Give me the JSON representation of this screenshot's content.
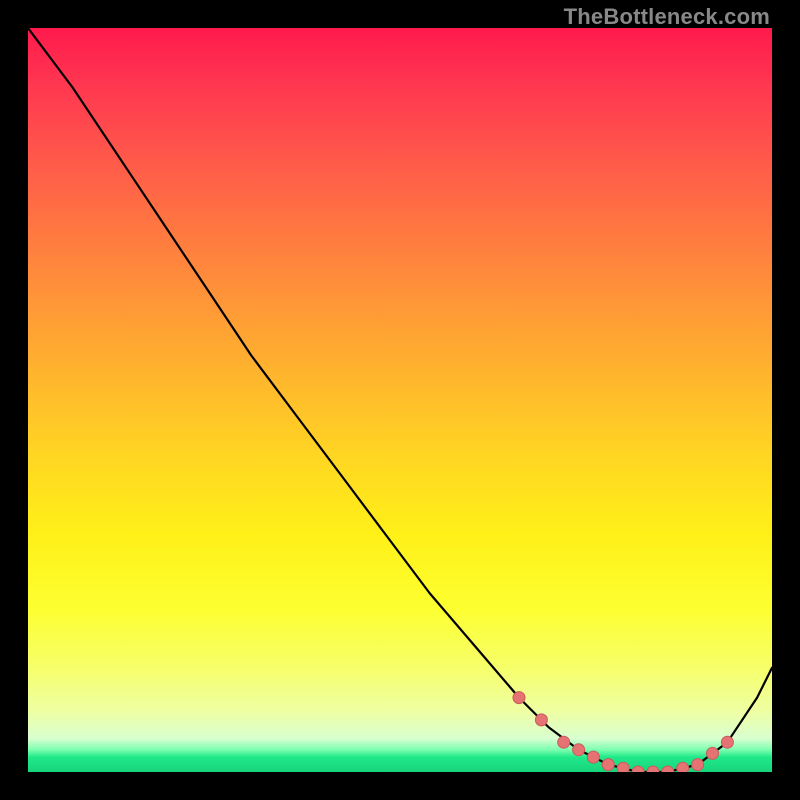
{
  "watermark": "TheBottleneck.com",
  "colors": {
    "curve": "#000000",
    "marker_fill": "#e57373",
    "marker_stroke": "#c95b5b",
    "bg_black": "#000000"
  },
  "chart_data": {
    "type": "line",
    "title": "",
    "xlabel": "",
    "ylabel": "",
    "xlim": [
      0,
      100
    ],
    "ylim": [
      0,
      100
    ],
    "grid": false,
    "legend": false,
    "series": [
      {
        "name": "curve",
        "x": [
          0,
          6,
          12,
          18,
          24,
          30,
          36,
          42,
          48,
          54,
          60,
          66,
          70,
          74,
          78,
          82,
          86,
          90,
          94,
          98,
          100
        ],
        "y": [
          100,
          92,
          83,
          74,
          65,
          56,
          48,
          40,
          32,
          24,
          17,
          10,
          6,
          3,
          1,
          0,
          0,
          1,
          4,
          10,
          14
        ]
      }
    ],
    "markers": {
      "name": "highlight-points",
      "x": [
        66,
        69,
        72,
        74,
        76,
        78,
        80,
        82,
        84,
        86,
        88,
        90,
        92,
        94
      ],
      "y": [
        10,
        7,
        4,
        3,
        2,
        1,
        0.5,
        0,
        0,
        0,
        0.5,
        1,
        2.5,
        4
      ]
    }
  }
}
